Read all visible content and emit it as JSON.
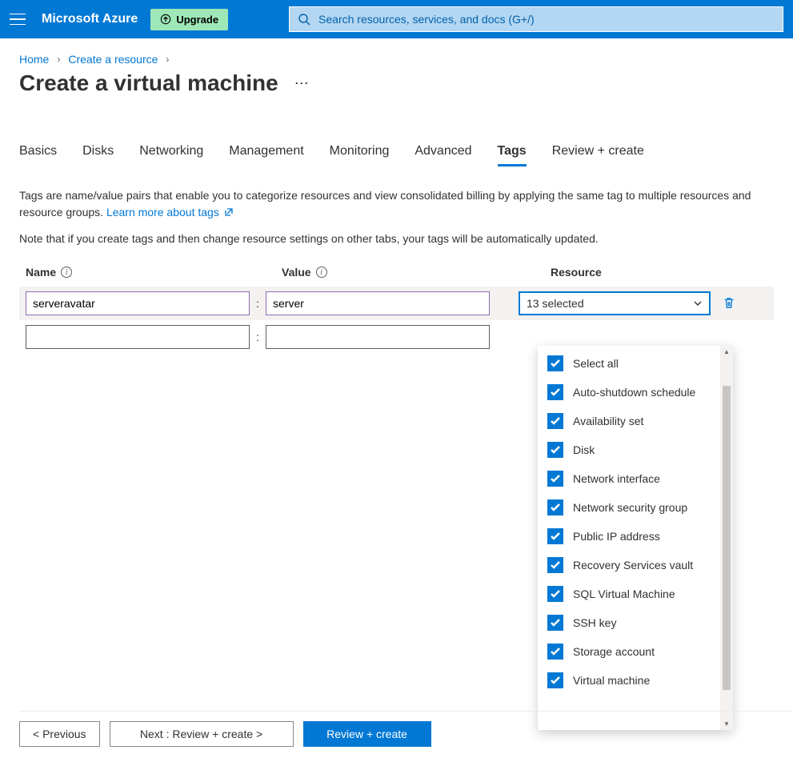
{
  "header": {
    "brand": "Microsoft Azure",
    "upgrade_label": "Upgrade",
    "search_placeholder": "Search resources, services, and docs (G+/)"
  },
  "breadcrumb": {
    "item1": "Home",
    "item2": "Create a resource"
  },
  "page_title": "Create a virtual machine",
  "tabs": {
    "basics": "Basics",
    "disks": "Disks",
    "networking": "Networking",
    "management": "Management",
    "monitoring": "Monitoring",
    "advanced": "Advanced",
    "tags": "Tags",
    "review": "Review + create"
  },
  "desc": {
    "text": "Tags are name/value pairs that enable you to categorize resources and view consolidated billing by applying the same tag to multiple resources and resource groups. ",
    "link": "Learn more about tags"
  },
  "note": "Note that if you create tags and then change resource settings on other tabs, your tags will be automatically updated.",
  "table": {
    "headers": {
      "name": "Name",
      "value": "Value",
      "resource": "Resource"
    },
    "rows": [
      {
        "name": "serveravatar",
        "value": "server",
        "resource": "13 selected"
      },
      {
        "name": "",
        "value": "",
        "resource": ""
      }
    ]
  },
  "dropdown": {
    "items": [
      "Select all",
      "Auto-shutdown schedule",
      "Availability set",
      "Disk",
      "Network interface",
      "Network security group",
      "Public IP address",
      "Recovery Services vault",
      "SQL Virtual Machine",
      "SSH key",
      "Storage account",
      "Virtual machine"
    ]
  },
  "footer": {
    "prev": "<  Previous",
    "next": "Next : Review + create  >",
    "review": "Review + create"
  }
}
